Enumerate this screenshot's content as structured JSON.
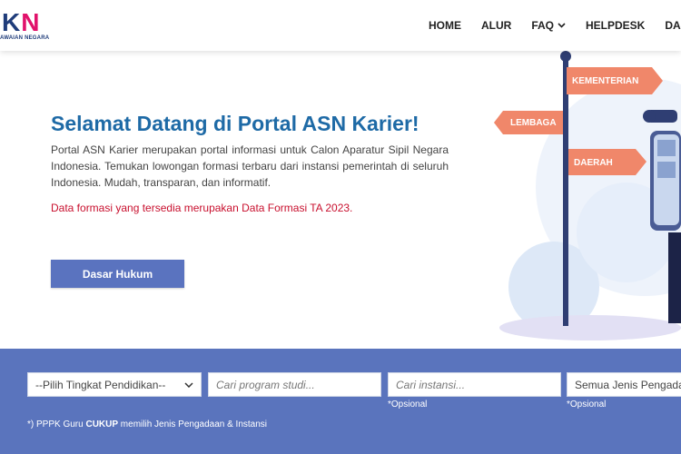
{
  "logo": {
    "letters_k": "K",
    "letters_n": "N",
    "subtitle": "AWAIAN NEGARA"
  },
  "nav": {
    "items": [
      {
        "label": "HOME"
      },
      {
        "label": "ALUR"
      },
      {
        "label": "FAQ"
      },
      {
        "label": "HELPDESK"
      },
      {
        "label": "DASAR"
      }
    ]
  },
  "hero": {
    "title": "Selamat Datang di Portal ASN Karier!",
    "description": "Portal ASN Karier merupakan portal informasi untuk Calon Aparatur Sipil Negara Indonesia. Temukan lowongan formasi terbaru dari instansi pemerintah di seluruh Indonesia. Mudah, transparan, dan informatif.",
    "note": "Data formasi yang tersedia merupakan Data Formasi TA 2023.",
    "button_label": "Dasar Hukum"
  },
  "illustration": {
    "signs": [
      "KEMENTERIAN",
      "LEMBAGA",
      "DAERAH"
    ],
    "colors": {
      "sign": "#f0876a",
      "pole": "#2f3e73",
      "blob": "#dde8f7"
    }
  },
  "search": {
    "education_select": "--Pilih Tingkat Pendidikan--",
    "program_placeholder": "Cari program studi...",
    "institution_placeholder": "Cari instansi...",
    "institution_hint": "*Opsional",
    "type_select": "Semua Jenis Pengadaan",
    "type_hint": "*Opsional",
    "footnote_prefix": "*) PPPK Guru ",
    "footnote_bold": "CUKUP",
    "footnote_suffix": " memilih Jenis Pengadaan & Instansi"
  },
  "colors": {
    "title": "#1e6aa6",
    "note": "#c8102e",
    "button": "#5a73bf",
    "band": "#5a74bd"
  }
}
